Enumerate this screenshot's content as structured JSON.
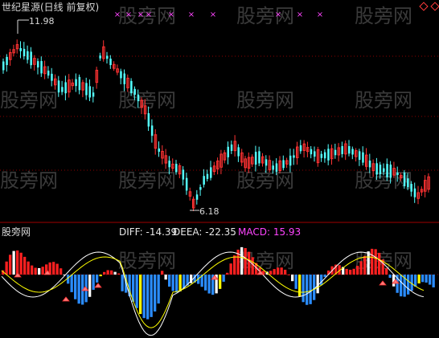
{
  "header": {
    "title": "世纪星源(日线 前复权)",
    "high_price_label": "11.98",
    "low_price_label": "6.18"
  },
  "indicator": {
    "panel_title": "股旁网",
    "diff_label": "DIFF: -14.39",
    "deea_label": "DEEA: -22.35",
    "macd_label": "MACD: 15.93"
  },
  "watermark": {
    "text": "股旁网"
  },
  "signal_marker": "×",
  "colors": {
    "up": "#ff3333",
    "down": "#54ffff",
    "macd_red": "#ff2020",
    "macd_blue": "#2a8cff",
    "macd_white": "#ffffff",
    "macd_yellow": "#ffff00",
    "diff_line": "#ffffff",
    "dea_line": "#ffff00",
    "marker": "#ff44ff",
    "grid": "#8b0000"
  }
}
